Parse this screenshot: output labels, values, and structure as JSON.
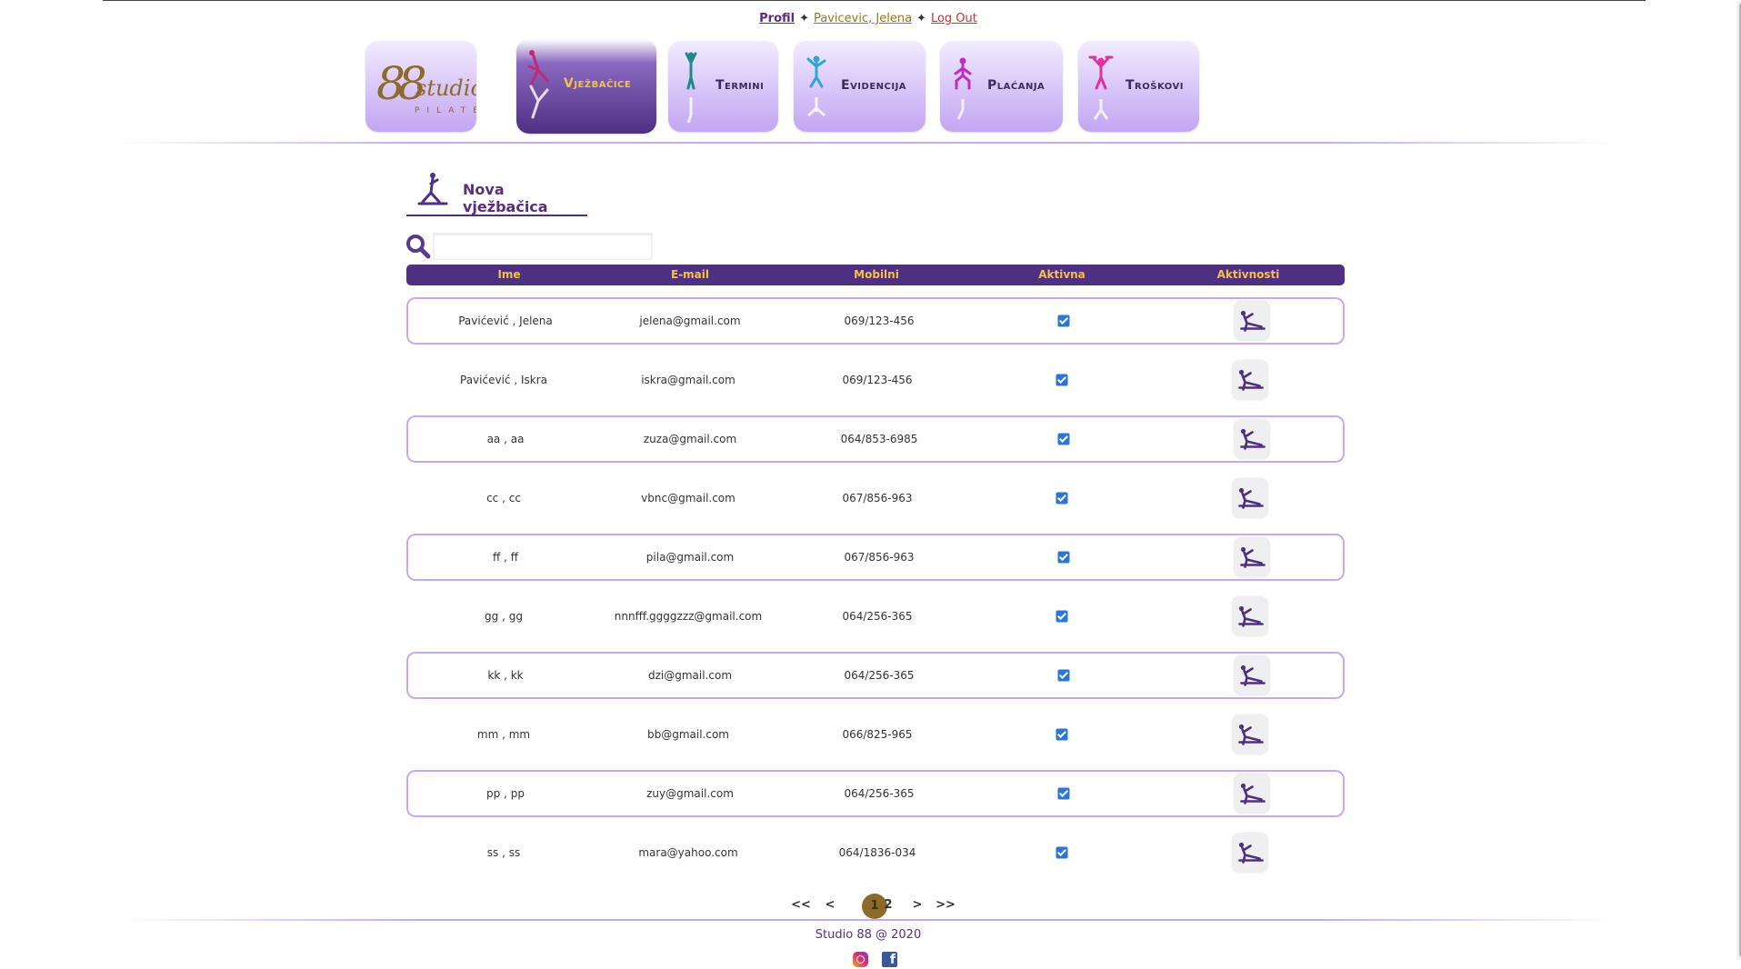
{
  "topbar": {
    "profile_link": "Profil",
    "user_link": "Pavicevic, Jelena",
    "logout_link": "Log Out",
    "separator": "✦"
  },
  "nav": {
    "logo": {
      "big": "88",
      "word": "studio",
      "sub": "PILATES"
    },
    "tabs": [
      {
        "label": "Vježbačice",
        "active": true
      },
      {
        "label": "Termini",
        "active": false
      },
      {
        "label": "Evidencija",
        "active": false
      },
      {
        "label": "Plaćanja",
        "active": false
      },
      {
        "label": "Troškovi",
        "active": false
      }
    ]
  },
  "new_button": {
    "label": "Nova vježbačica"
  },
  "search": {
    "placeholder": "",
    "value": ""
  },
  "table": {
    "headers": [
      "Ime",
      "E-mail",
      "Mobilni",
      "Aktivna",
      "Aktivnosti"
    ],
    "rows": [
      {
        "name": "Pavićević , Jelena",
        "email": "jelena@gmail.com",
        "phone": "069/123-456",
        "active": true
      },
      {
        "name": "Pavićević , Iskra",
        "email": "iskra@gmail.com",
        "phone": "069/123-456",
        "active": true
      },
      {
        "name": "aa , aa",
        "email": "zuza@gmail.com",
        "phone": "064/853-6985",
        "active": true
      },
      {
        "name": "cc , cc",
        "email": "vbnc@gmail.com",
        "phone": "067/856-963",
        "active": true
      },
      {
        "name": "ff , ff",
        "email": "pila@gmail.com",
        "phone": "067/856-963",
        "active": true
      },
      {
        "name": "gg , gg",
        "email": "nnnfff.ggggzzz@gmail.com",
        "phone": "064/256-365",
        "active": true
      },
      {
        "name": "kk , kk",
        "email": "dzi@gmail.com",
        "phone": "064/256-365",
        "active": true
      },
      {
        "name": "mm , mm",
        "email": "bb@gmail.com",
        "phone": "066/825-965",
        "active": true
      },
      {
        "name": "pp , pp",
        "email": "zuy@gmail.com",
        "phone": "064/256-365",
        "active": true
      },
      {
        "name": "ss , ss",
        "email": "mara@yahoo.com",
        "phone": "064/1836-034",
        "active": true
      }
    ]
  },
  "pagination": {
    "first": "<<",
    "prev": "<",
    "current": "1",
    "next_page": "2",
    "next": ">",
    "last": ">>"
  },
  "footer": {
    "text": "Studio 88 @ 2020",
    "icons": [
      "instagram-icon",
      "facebook-icon"
    ]
  },
  "colors": {
    "primary": "#4e2f82",
    "accent": "#f4c24a",
    "gold": "#8b6a2c",
    "lavender": "#c9a8ee"
  }
}
